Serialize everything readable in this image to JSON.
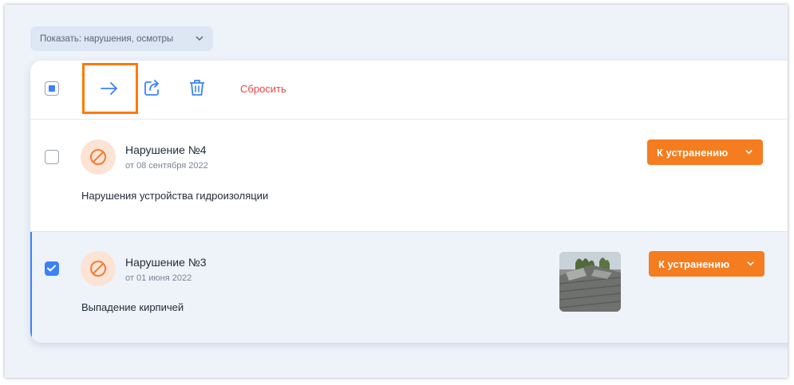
{
  "filter": {
    "label": "Показать: нарушения, осмотры"
  },
  "toolbar": {
    "reset_label": "Сбросить"
  },
  "items": [
    {
      "title": "Нарушение №4",
      "date": "от 08 сентября 2022",
      "description": "Нарушения устройства гидроизоляции",
      "status": "К устранению",
      "checked": false,
      "has_photo": false
    },
    {
      "title": "Нарушение №3",
      "date": "от 01 июня 2022",
      "description": "Выпадение кирпичей",
      "status": "К устранению",
      "checked": true,
      "has_photo": true
    }
  ],
  "colors": {
    "accent_blue": "#3b82f6",
    "status_orange": "#f57c1f",
    "reset_red": "#ef4444",
    "highlight_orange": "#ff7a00"
  },
  "icons": [
    "chevron-down-icon",
    "arrow-right-icon",
    "share-icon",
    "trash-icon",
    "prohibited-icon",
    "check-icon"
  ]
}
